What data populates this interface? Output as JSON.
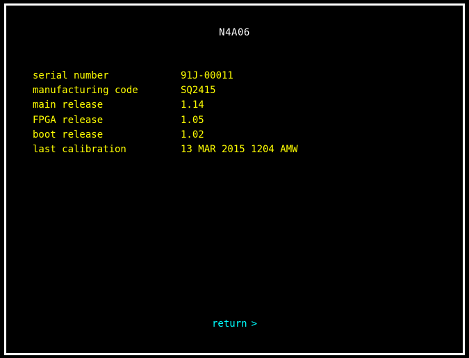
{
  "screen": {
    "title": "N4A06",
    "info_rows": [
      {
        "label": "serial number",
        "value": "91J-00011"
      },
      {
        "label": "manufacturing code",
        "value": "SQ2415"
      },
      {
        "label": "main release",
        "value": "1.14"
      },
      {
        "label": "FPGA release",
        "value": "1.05"
      },
      {
        "label": "boot release",
        "value": "1.02"
      },
      {
        "label": "last calibration",
        "value": "13 MAR 2015 1204 AMW"
      }
    ],
    "return_label": "return",
    "return_glyph": ">"
  },
  "colors": {
    "background": "#000000",
    "frame": "#ffffff",
    "title_text": "#ffffff",
    "info_text": "#ffff00",
    "link_text": "#00ffff"
  }
}
